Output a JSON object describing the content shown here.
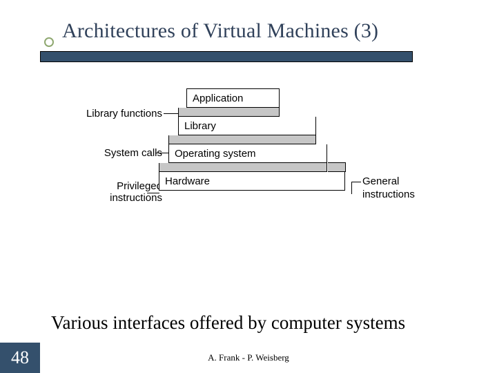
{
  "title": "Architectures of Virtual Machines (3)",
  "diagram": {
    "layers": {
      "application": "Application",
      "library": "Library",
      "os": "Operating system",
      "hardware": "Hardware"
    },
    "left_labels": {
      "library_functions": "Library functions",
      "system_calls": "System calls",
      "privileged_instructions_l1": "Privileged",
      "privileged_instructions_l2": "instructions"
    },
    "right_label_l1": "General",
    "right_label_l2": "instructions"
  },
  "caption": "Various interfaces offered by computer systems",
  "page_number": "48",
  "footer": "A. Frank - P. Weisberg"
}
